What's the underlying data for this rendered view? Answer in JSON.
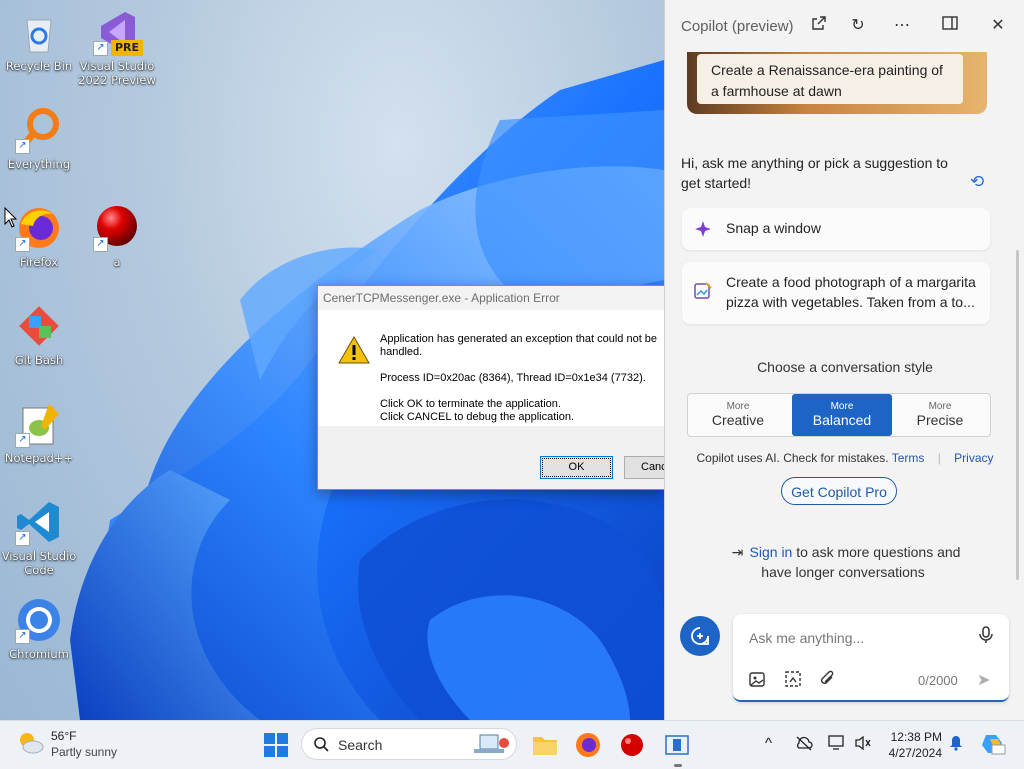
{
  "desktop": {
    "icons": [
      {
        "label": "Recycle Bin",
        "icon": "recycle-bin-icon"
      },
      {
        "label": "Visual Studio 2022 Preview",
        "icon": "visual-studio-icon",
        "badge": "PRE"
      },
      {
        "label": "Everything",
        "icon": "everything-search-icon"
      },
      {
        "label": "Firefox",
        "icon": "firefox-icon"
      },
      {
        "label": "a",
        "icon": "red-ball-icon"
      },
      {
        "label": "Git Bash",
        "icon": "git-bash-icon"
      },
      {
        "label": "Notepad++",
        "icon": "notepad-plus-plus-icon"
      },
      {
        "label": "Visual Studio Code",
        "icon": "vscode-icon"
      },
      {
        "label": "Chromium",
        "icon": "chromium-icon"
      }
    ]
  },
  "dialog": {
    "title": "CenerTCPMessenger.exe - Application Error",
    "message_1": "Application has generated an exception that could not be handled.",
    "message_2": "Process ID=0x20ac (8364), Thread ID=0x1e34 (7732).",
    "message_3": "Click OK to terminate the application.\nClick CANCEL to debug the application.",
    "ok_label": "OK",
    "cancel_label": "Cancel",
    "icon": "warning-icon"
  },
  "copilot": {
    "title": "Copilot (preview)",
    "header_icons": [
      "open-external-icon",
      "refresh-icon",
      "more-icon",
      "dock-panel-icon",
      "close-icon"
    ],
    "top_suggestion": "Create a Renaissance-era painting of a farmhouse at dawn",
    "greeting": "Hi, ask me anything or pick a suggestion to get started!",
    "suggestions": [
      {
        "label": "Snap a window",
        "icon": "sparkle-icon"
      },
      {
        "label": "Create a food photograph of a margarita pizza with vegetables. Taken from a to...",
        "icon": "image-create-icon"
      }
    ],
    "style_label": "Choose a conversation style",
    "styles": [
      {
        "small": "More",
        "big": "Creative",
        "active": false
      },
      {
        "small": "More",
        "big": "Balanced",
        "active": true
      },
      {
        "small": "More",
        "big": "Precise",
        "active": false
      }
    ],
    "disclaimer": "Copilot uses AI. Check for mistakes.",
    "terms": "Terms",
    "privacy": "Privacy",
    "pro_button": "Get Copilot Pro",
    "signin_link": "Sign in",
    "signin_rest": " to ask more questions and have longer conversations",
    "input_placeholder": "Ask me anything...",
    "char_count": "0/2000"
  },
  "taskbar": {
    "weather_temp": "56°F",
    "weather_cond": "Partly sunny",
    "search_label": "Search",
    "time": "12:38 PM",
    "date": "4/27/2024",
    "accent": "#1d64c5"
  }
}
